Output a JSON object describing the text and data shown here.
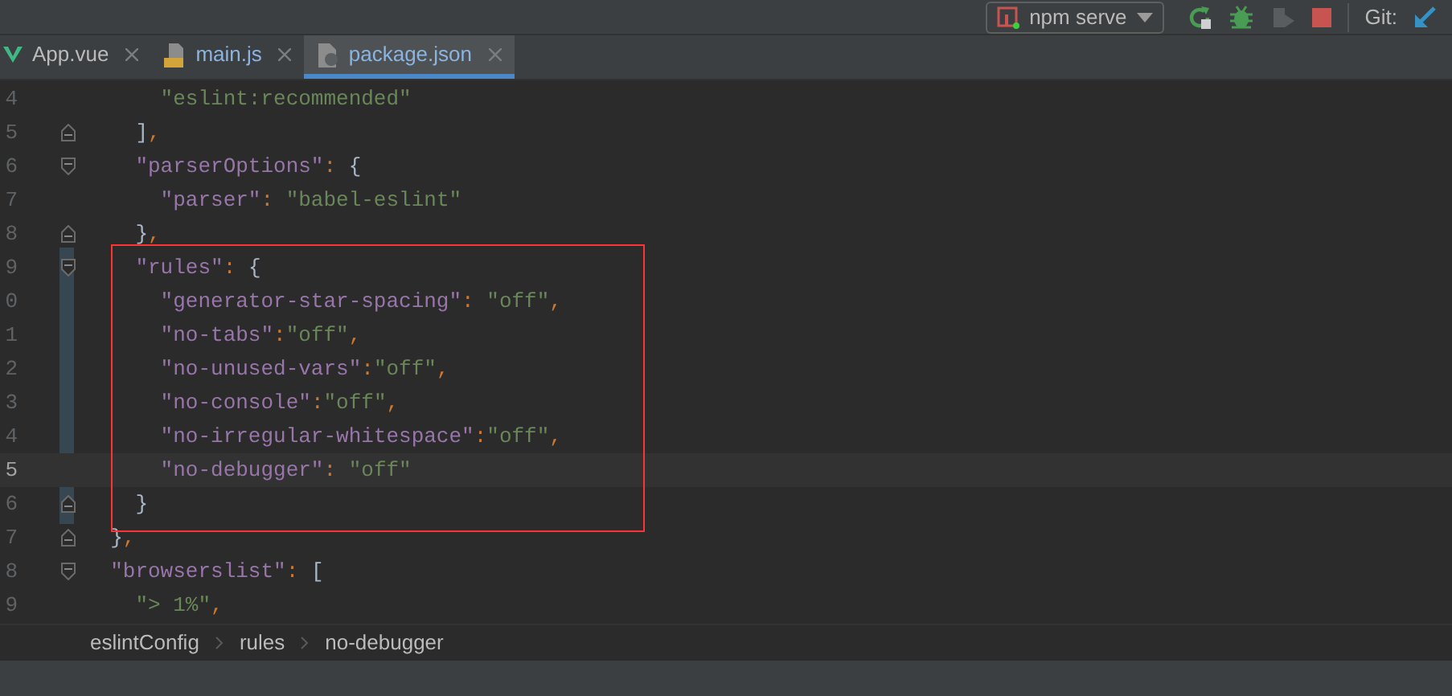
{
  "toolbar": {
    "run_config": "npm serve",
    "git_label": "Git:"
  },
  "tabs": [
    {
      "label": "App.vue",
      "kind": "vue",
      "selected": false
    },
    {
      "label": "main.js",
      "kind": "js",
      "selected": false
    },
    {
      "label": "package.json",
      "kind": "json",
      "selected": true
    }
  ],
  "lines": [
    {
      "number": "4",
      "current": false,
      "kind": "plain",
      "tokens": [
        {
          "kind": "string",
          "text": "      \"eslint:recommended\""
        }
      ]
    },
    {
      "number": "5",
      "current": false,
      "kind": "fold_end",
      "tokens": [
        {
          "kind": "plain",
          "text": "    ]"
        },
        {
          "kind": "punct",
          "text": ","
        }
      ]
    },
    {
      "number": "6",
      "current": false,
      "kind": "fold_start",
      "tokens": [
        {
          "kind": "key",
          "text": "    \"parserOptions\""
        },
        {
          "kind": "punct",
          "text": ": "
        },
        {
          "kind": "plain",
          "text": "{"
        }
      ]
    },
    {
      "number": "7",
      "current": false,
      "kind": "plain",
      "tokens": [
        {
          "kind": "key",
          "text": "      \"parser\""
        },
        {
          "kind": "punct",
          "text": ": "
        },
        {
          "kind": "string",
          "text": "\"babel-eslint\""
        }
      ]
    },
    {
      "number": "8",
      "current": false,
      "kind": "fold_end",
      "tokens": [
        {
          "kind": "plain",
          "text": "    }"
        },
        {
          "kind": "punct",
          "text": ","
        }
      ]
    },
    {
      "number": "9",
      "current": false,
      "kind": "fold_start",
      "tokens": [
        {
          "kind": "key",
          "text": "    \"rules\""
        },
        {
          "kind": "punct",
          "text": ": "
        },
        {
          "kind": "plain",
          "text": "{"
        }
      ]
    },
    {
      "number": "0",
      "current": false,
      "kind": "plain",
      "tokens": [
        {
          "kind": "key",
          "text": "      \"generator-star-spacing\""
        },
        {
          "kind": "punct",
          "text": ": "
        },
        {
          "kind": "string",
          "text": "\"off\""
        },
        {
          "kind": "punct",
          "text": ","
        }
      ]
    },
    {
      "number": "1",
      "current": false,
      "kind": "plain",
      "tokens": [
        {
          "kind": "key",
          "text": "      \"no-tabs\""
        },
        {
          "kind": "punct",
          "text": ":"
        },
        {
          "kind": "string",
          "text": "\"off\""
        },
        {
          "kind": "punct",
          "text": ","
        }
      ]
    },
    {
      "number": "2",
      "current": false,
      "kind": "plain",
      "tokens": [
        {
          "kind": "key",
          "text": "      \"no-unused-vars\""
        },
        {
          "kind": "punct",
          "text": ":"
        },
        {
          "kind": "string",
          "text": "\"off\""
        },
        {
          "kind": "punct",
          "text": ","
        }
      ]
    },
    {
      "number": "3",
      "current": false,
      "kind": "plain",
      "tokens": [
        {
          "kind": "key",
          "text": "      \"no-console\""
        },
        {
          "kind": "punct",
          "text": ":"
        },
        {
          "kind": "string",
          "text": "\"off\""
        },
        {
          "kind": "punct",
          "text": ","
        }
      ]
    },
    {
      "number": "4",
      "current": false,
      "kind": "plain",
      "tokens": [
        {
          "kind": "key",
          "text": "      \"no-irregular-whitespace\""
        },
        {
          "kind": "punct",
          "text": ":"
        },
        {
          "kind": "string",
          "text": "\"off\""
        },
        {
          "kind": "punct",
          "text": ","
        }
      ]
    },
    {
      "number": "5",
      "current": true,
      "kind": "plain",
      "tokens": [
        {
          "kind": "key",
          "text": "      \"no-debugger\""
        },
        {
          "kind": "punct",
          "text": ": "
        },
        {
          "kind": "string",
          "text": "\"off\""
        }
      ]
    },
    {
      "number": "6",
      "current": false,
      "kind": "fold_end",
      "tokens": [
        {
          "kind": "plain",
          "text": "    }"
        }
      ]
    },
    {
      "number": "7",
      "current": false,
      "kind": "fold_end",
      "tokens": [
        {
          "kind": "plain",
          "text": "  }"
        },
        {
          "kind": "punct",
          "text": ","
        }
      ]
    },
    {
      "number": "8",
      "current": false,
      "kind": "fold_start",
      "tokens": [
        {
          "kind": "key",
          "text": "  \"browserslist\""
        },
        {
          "kind": "punct",
          "text": ": "
        },
        {
          "kind": "plain",
          "text": "["
        }
      ]
    },
    {
      "number": "9",
      "current": false,
      "kind": "plain",
      "tokens": [
        {
          "kind": "string",
          "text": "    \"> 1%\""
        },
        {
          "kind": "punct",
          "text": ","
        }
      ]
    }
  ],
  "breadcrumbs": [
    "eslintConfig",
    "rules",
    "no-debugger"
  ]
}
